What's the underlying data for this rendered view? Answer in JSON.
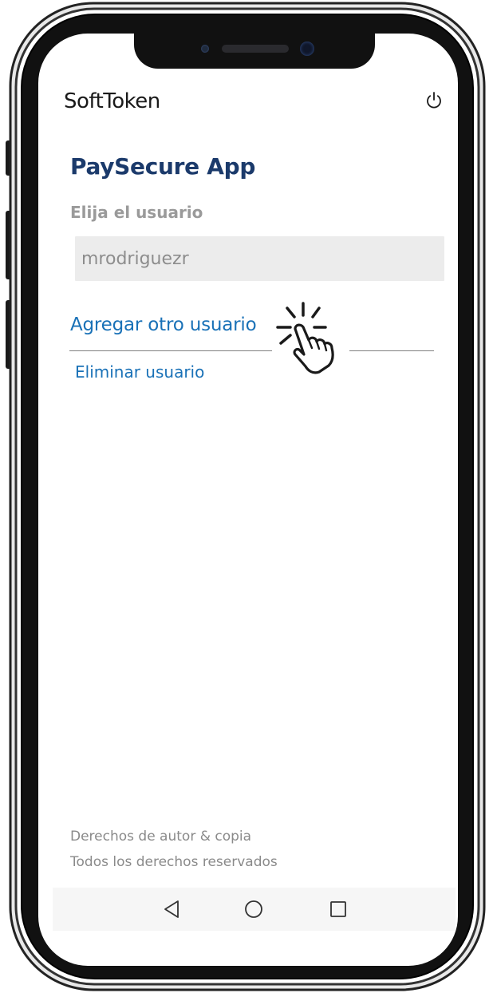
{
  "header": {
    "title": "SoftToken",
    "power_icon": "power-icon"
  },
  "main": {
    "app_name": "PaySecure App",
    "choose_user_label": "Elija el usuario",
    "selected_user": "mrodriguezr",
    "add_user_label": "Agregar otro usuario",
    "remove_user_label": "Eliminar usuario",
    "tap_indicator_icon": "tap-hand-icon"
  },
  "footer": {
    "line1": "Derechos de autor & copia",
    "line2": "Todos los derechos reservados"
  },
  "navbar": {
    "back_icon": "back-triangle-icon",
    "home_icon": "home-circle-icon",
    "recents_icon": "recents-square-icon"
  },
  "colors": {
    "brand": "#1b3a6b",
    "link": "#1971b7",
    "muted": "#9a9a9a",
    "field_bg": "#ececec"
  }
}
